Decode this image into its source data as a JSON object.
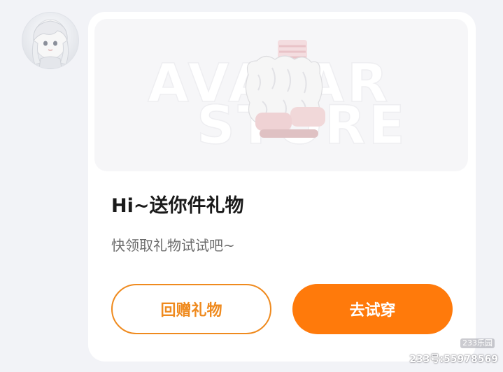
{
  "sender": {
    "avatar_icon": "user-avatar-anime-girl"
  },
  "gift_card": {
    "banner_watermark_line1": "AVATAR",
    "banner_watermark_line2": "STORE",
    "product_icon": "fluffy-white-boots",
    "title": "Hi~送你件礼物",
    "subtitle": "快领取礼物试试吧~",
    "return_gift_label": "回赠礼物",
    "try_on_label": "去试穿",
    "accent_color": "#ff7a0b"
  },
  "watermark": {
    "site_badge": "233乐园",
    "id_text": "233号:55978569"
  }
}
